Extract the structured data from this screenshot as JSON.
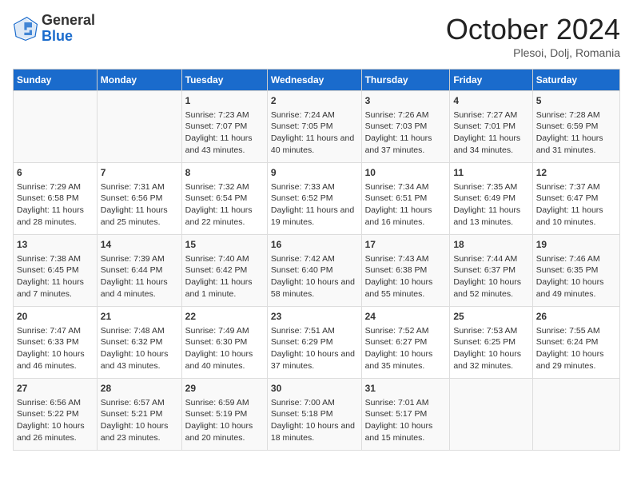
{
  "header": {
    "logo_general": "General",
    "logo_blue": "Blue",
    "month_title": "October 2024",
    "location": "Plesoi, Dolj, Romania"
  },
  "days_of_week": [
    "Sunday",
    "Monday",
    "Tuesday",
    "Wednesday",
    "Thursday",
    "Friday",
    "Saturday"
  ],
  "weeks": [
    [
      {
        "day": "",
        "content": ""
      },
      {
        "day": "",
        "content": ""
      },
      {
        "day": "1",
        "content": "Sunrise: 7:23 AM\nSunset: 7:07 PM\nDaylight: 11 hours and 43 minutes."
      },
      {
        "day": "2",
        "content": "Sunrise: 7:24 AM\nSunset: 7:05 PM\nDaylight: 11 hours and 40 minutes."
      },
      {
        "day": "3",
        "content": "Sunrise: 7:26 AM\nSunset: 7:03 PM\nDaylight: 11 hours and 37 minutes."
      },
      {
        "day": "4",
        "content": "Sunrise: 7:27 AM\nSunset: 7:01 PM\nDaylight: 11 hours and 34 minutes."
      },
      {
        "day": "5",
        "content": "Sunrise: 7:28 AM\nSunset: 6:59 PM\nDaylight: 11 hours and 31 minutes."
      }
    ],
    [
      {
        "day": "6",
        "content": "Sunrise: 7:29 AM\nSunset: 6:58 PM\nDaylight: 11 hours and 28 minutes."
      },
      {
        "day": "7",
        "content": "Sunrise: 7:31 AM\nSunset: 6:56 PM\nDaylight: 11 hours and 25 minutes."
      },
      {
        "day": "8",
        "content": "Sunrise: 7:32 AM\nSunset: 6:54 PM\nDaylight: 11 hours and 22 minutes."
      },
      {
        "day": "9",
        "content": "Sunrise: 7:33 AM\nSunset: 6:52 PM\nDaylight: 11 hours and 19 minutes."
      },
      {
        "day": "10",
        "content": "Sunrise: 7:34 AM\nSunset: 6:51 PM\nDaylight: 11 hours and 16 minutes."
      },
      {
        "day": "11",
        "content": "Sunrise: 7:35 AM\nSunset: 6:49 PM\nDaylight: 11 hours and 13 minutes."
      },
      {
        "day": "12",
        "content": "Sunrise: 7:37 AM\nSunset: 6:47 PM\nDaylight: 11 hours and 10 minutes."
      }
    ],
    [
      {
        "day": "13",
        "content": "Sunrise: 7:38 AM\nSunset: 6:45 PM\nDaylight: 11 hours and 7 minutes."
      },
      {
        "day": "14",
        "content": "Sunrise: 7:39 AM\nSunset: 6:44 PM\nDaylight: 11 hours and 4 minutes."
      },
      {
        "day": "15",
        "content": "Sunrise: 7:40 AM\nSunset: 6:42 PM\nDaylight: 11 hours and 1 minute."
      },
      {
        "day": "16",
        "content": "Sunrise: 7:42 AM\nSunset: 6:40 PM\nDaylight: 10 hours and 58 minutes."
      },
      {
        "day": "17",
        "content": "Sunrise: 7:43 AM\nSunset: 6:38 PM\nDaylight: 10 hours and 55 minutes."
      },
      {
        "day": "18",
        "content": "Sunrise: 7:44 AM\nSunset: 6:37 PM\nDaylight: 10 hours and 52 minutes."
      },
      {
        "day": "19",
        "content": "Sunrise: 7:46 AM\nSunset: 6:35 PM\nDaylight: 10 hours and 49 minutes."
      }
    ],
    [
      {
        "day": "20",
        "content": "Sunrise: 7:47 AM\nSunset: 6:33 PM\nDaylight: 10 hours and 46 minutes."
      },
      {
        "day": "21",
        "content": "Sunrise: 7:48 AM\nSunset: 6:32 PM\nDaylight: 10 hours and 43 minutes."
      },
      {
        "day": "22",
        "content": "Sunrise: 7:49 AM\nSunset: 6:30 PM\nDaylight: 10 hours and 40 minutes."
      },
      {
        "day": "23",
        "content": "Sunrise: 7:51 AM\nSunset: 6:29 PM\nDaylight: 10 hours and 37 minutes."
      },
      {
        "day": "24",
        "content": "Sunrise: 7:52 AM\nSunset: 6:27 PM\nDaylight: 10 hours and 35 minutes."
      },
      {
        "day": "25",
        "content": "Sunrise: 7:53 AM\nSunset: 6:25 PM\nDaylight: 10 hours and 32 minutes."
      },
      {
        "day": "26",
        "content": "Sunrise: 7:55 AM\nSunset: 6:24 PM\nDaylight: 10 hours and 29 minutes."
      }
    ],
    [
      {
        "day": "27",
        "content": "Sunrise: 6:56 AM\nSunset: 5:22 PM\nDaylight: 10 hours and 26 minutes."
      },
      {
        "day": "28",
        "content": "Sunrise: 6:57 AM\nSunset: 5:21 PM\nDaylight: 10 hours and 23 minutes."
      },
      {
        "day": "29",
        "content": "Sunrise: 6:59 AM\nSunset: 5:19 PM\nDaylight: 10 hours and 20 minutes."
      },
      {
        "day": "30",
        "content": "Sunrise: 7:00 AM\nSunset: 5:18 PM\nDaylight: 10 hours and 18 minutes."
      },
      {
        "day": "31",
        "content": "Sunrise: 7:01 AM\nSunset: 5:17 PM\nDaylight: 10 hours and 15 minutes."
      },
      {
        "day": "",
        "content": ""
      },
      {
        "day": "",
        "content": ""
      }
    ]
  ]
}
